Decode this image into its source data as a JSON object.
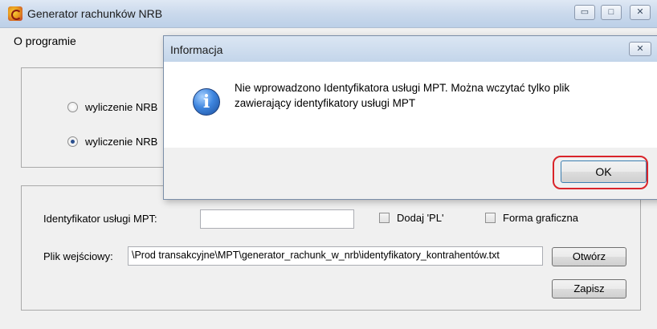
{
  "window": {
    "title": "Generator rachunków NRB",
    "minimize_glyph": "▭",
    "maximize_glyph": "□",
    "close_glyph": "✕"
  },
  "menu": {
    "items": [
      {
        "label": "O programie"
      }
    ]
  },
  "mode_group": {
    "options": [
      {
        "label": "wyliczenie NRB",
        "selected": false
      },
      {
        "label": "wyliczenie NRB",
        "selected": true
      }
    ]
  },
  "form": {
    "mpt_label": "Identyfikator usługi MPT:",
    "mpt_value": "",
    "add_pl_label": "Dodaj 'PL'",
    "add_pl_checked": false,
    "graphic_label": "Forma graficzna",
    "graphic_checked": false,
    "input_file_label": "Plik wejściowy:",
    "input_file_value": "\\Prod transakcyjne\\MPT\\generator_rachunk_w_nrb\\identyfikatory_kontrahentów.txt",
    "open_button": "Otwórz",
    "save_button": "Zapisz"
  },
  "dialog": {
    "title": "Informacja",
    "close_glyph": "✕",
    "icon": "info-icon",
    "icon_glyph": "i",
    "message_line1": "Nie wprowadzono Identyfikatora usługi MPT. Można wczytać tylko plik",
    "message_line2": "zawierający identyfikatory usługi MPT",
    "ok_button": "OK",
    "highlight_color": "#d9242a"
  }
}
